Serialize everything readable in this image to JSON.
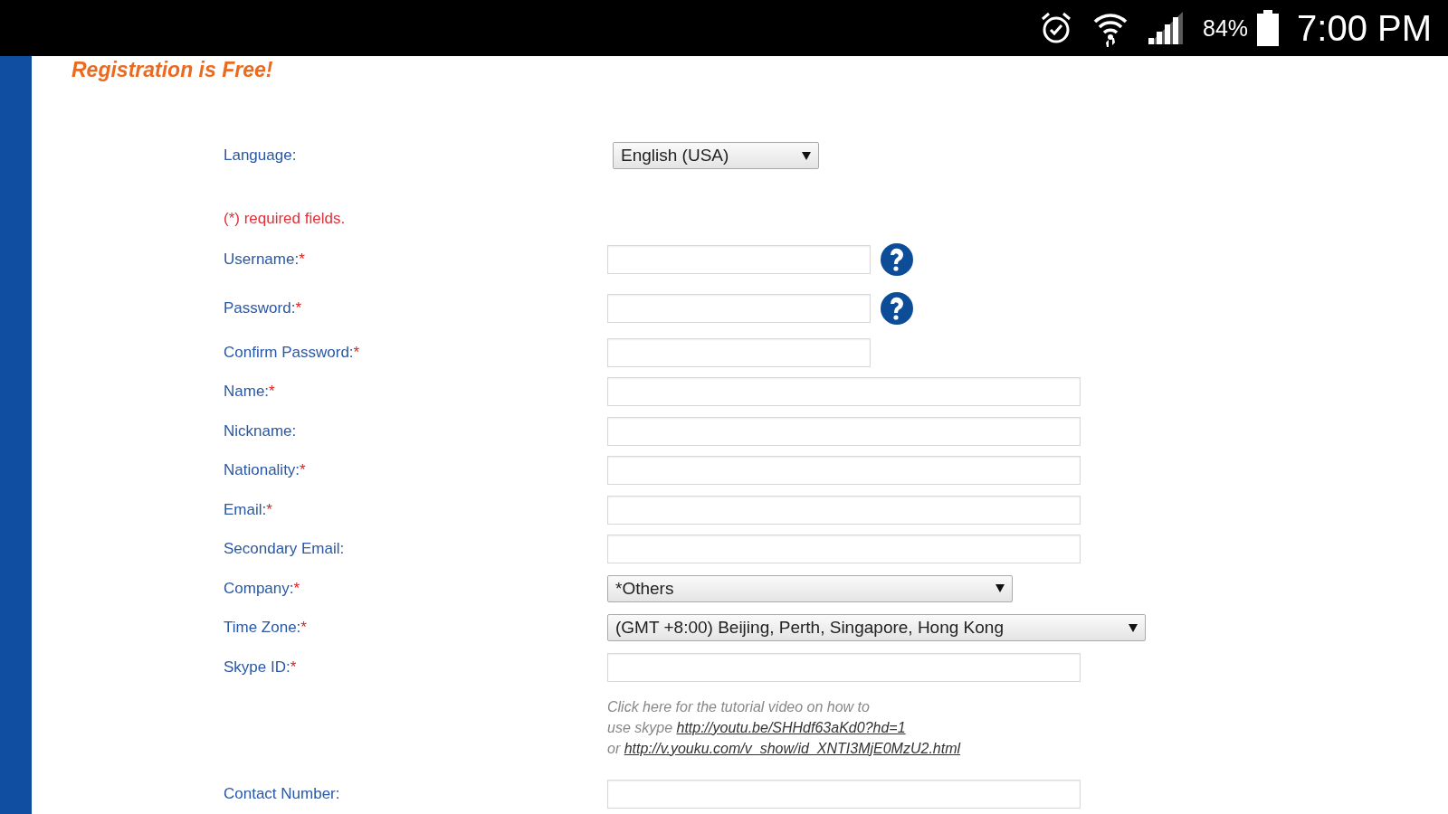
{
  "status_bar": {
    "battery": "84%",
    "time": "7:00 PM"
  },
  "title": "Registration is Free!",
  "language": {
    "label": "Language:",
    "value": "English (USA)"
  },
  "required_note": "(*) required fields.",
  "fields": [
    {
      "label": "Username:",
      "required_mark": "*",
      "kind": "short",
      "help": true
    },
    {
      "label": "Password:",
      "required_mark": "*",
      "kind": "short",
      "help": true
    },
    {
      "label": "Confirm Password:",
      "required_mark": "*",
      "kind": "short",
      "help": false
    },
    {
      "label": "Name:",
      "required_mark": "*",
      "kind": "long",
      "help": false
    },
    {
      "label": "Nickname:",
      "kind": "long",
      "help": false
    },
    {
      "label": "Nationality:",
      "required_mark": "*",
      "kind": "long",
      "help": false
    },
    {
      "label": "Email:",
      "required_mark": "*",
      "kind": "long",
      "help": false
    },
    {
      "label": "Secondary Email:",
      "kind": "long",
      "help": false
    },
    {
      "label": "Company:",
      "required_mark": "*",
      "kind": "select",
      "value": "*Others",
      "help": false
    },
    {
      "label": "Time Zone:",
      "required_mark": "*",
      "kind": "wideselect",
      "value": "(GMT +8:00) Beijing, Perth, Singapore, Hong Kong",
      "help": false
    },
    {
      "label": "Skype ID:",
      "required_mark": "*",
      "kind": "long",
      "help": false
    }
  ],
  "skype_help": [
    {
      "text": "Click here for the tutorial video on how to"
    },
    {
      "text": "use skype ",
      "link": "http://youtu.be/SHHdf63aKd0?hd=1"
    },
    {
      "text": "or ",
      "link": "http://v.youku.com/v_show/id_XNTI3MjE0MzU2.html"
    }
  ],
  "contact": {
    "label": "Contact Number:"
  }
}
